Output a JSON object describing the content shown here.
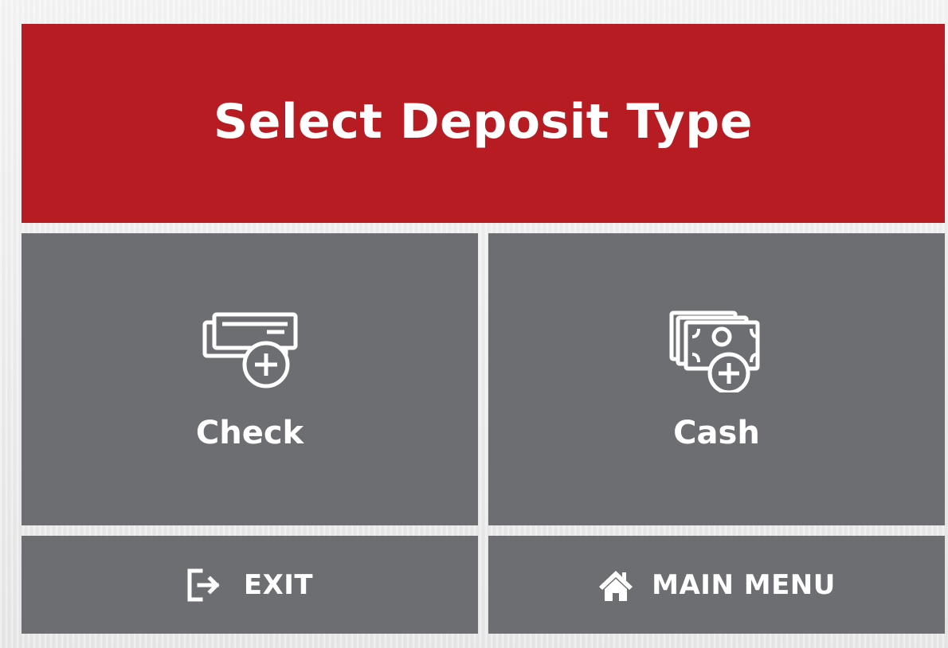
{
  "header": {
    "title": "Select Deposit Type"
  },
  "options": {
    "check": {
      "label": "Check",
      "icon": "check-add-icon"
    },
    "cash": {
      "label": "Cash",
      "icon": "cash-add-icon"
    }
  },
  "footer": {
    "exit": {
      "label": "EXIT",
      "icon": "exit-icon"
    },
    "main_menu": {
      "label": "MAIN MENU",
      "icon": "home-icon"
    }
  },
  "colors": {
    "header_bg": "#b71c22",
    "tile_bg": "#6d6e71",
    "text": "#ffffff",
    "page_bg": "#ececec"
  }
}
